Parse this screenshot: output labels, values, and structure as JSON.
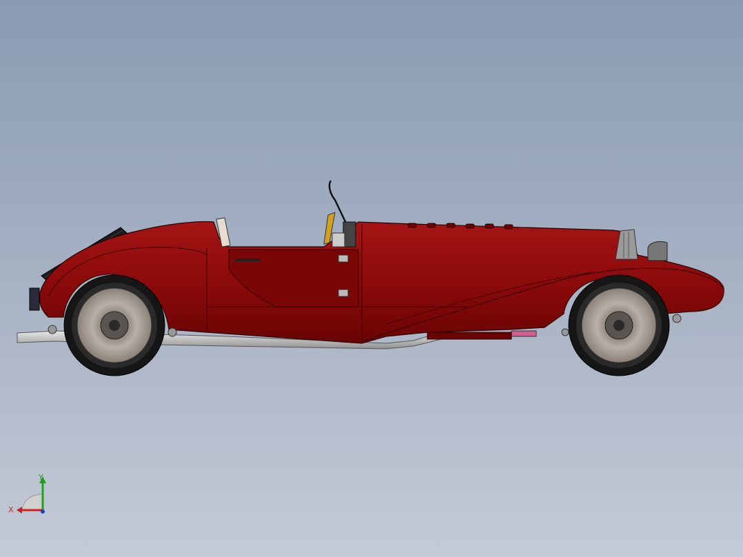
{
  "viewport": {
    "background_top": "#8a9ab0",
    "background_bottom": "#c4cad6"
  },
  "model": {
    "body_color": "#8b0a0a",
    "body_shade": "#5c0000",
    "tire_color": "#1a1a1a",
    "wheel_spoke_color": "#b8b0a8",
    "exhaust_color": "#c8c8c8",
    "dashboard_color": "#d4a020"
  },
  "triad": {
    "x_label": "X",
    "y_label": "Y",
    "x_color": "#cc2020",
    "y_color": "#20a020",
    "z_color": "#2040cc"
  }
}
